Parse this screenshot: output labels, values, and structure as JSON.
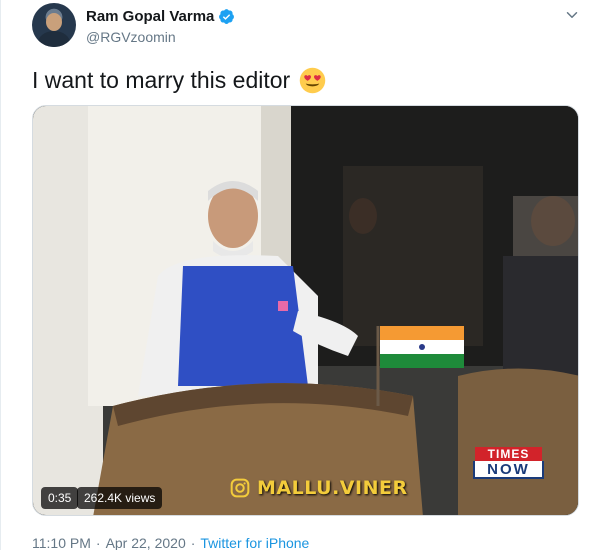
{
  "author": {
    "name": "Ram Gopal Varma",
    "handle": "@RGVzoomin",
    "verified": true,
    "avatar_icon": "profile-photo"
  },
  "tweet": {
    "text": "I want to marry this editor",
    "emoji": "heart-eyes-face-emoji"
  },
  "video": {
    "duration": "0:35",
    "views": "262.4K views",
    "watermark": "MALLU.VINER",
    "channel_logo_top": "TIMES",
    "channel_logo_bottom": "NOW"
  },
  "meta": {
    "time": "11:10 PM",
    "date": "Apr 22, 2020",
    "separator": "·",
    "source": "Twitter for iPhone"
  },
  "colors": {
    "accent": "#1b95e0",
    "secondary_text": "#657786",
    "watermark": "#f3cc3b"
  }
}
